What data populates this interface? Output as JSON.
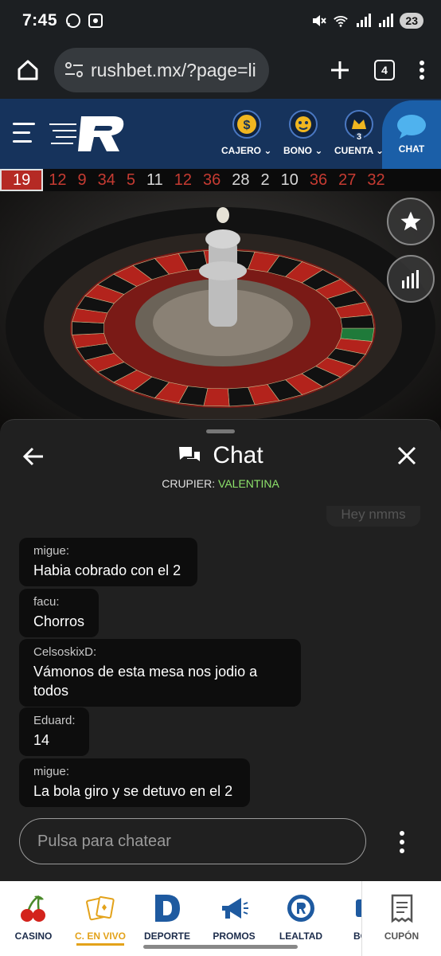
{
  "status_bar": {
    "time": "7:45",
    "battery": "23"
  },
  "browser": {
    "url": "rushbet.mx/?page=li",
    "tab_count": "4"
  },
  "header": {
    "nav": [
      {
        "label": "CAJERO",
        "icon": "dollar-coin-icon"
      },
      {
        "label": "BONO",
        "icon": "bonus-icon"
      },
      {
        "label": "CUENTA",
        "icon": "account-badge-icon",
        "badge": "3"
      }
    ],
    "chat_label": "CHAT"
  },
  "results": [
    {
      "n": "19",
      "color": "red"
    },
    {
      "n": "12",
      "color": "red"
    },
    {
      "n": "9",
      "color": "red"
    },
    {
      "n": "34",
      "color": "red"
    },
    {
      "n": "5",
      "color": "red"
    },
    {
      "n": "11",
      "color": "black"
    },
    {
      "n": "12",
      "color": "red"
    },
    {
      "n": "36",
      "color": "red"
    },
    {
      "n": "28",
      "color": "black"
    },
    {
      "n": "2",
      "color": "black"
    },
    {
      "n": "10",
      "color": "black"
    },
    {
      "n": "36",
      "color": "red"
    },
    {
      "n": "27",
      "color": "red"
    },
    {
      "n": "32",
      "color": "red"
    }
  ],
  "chat": {
    "title": "Chat",
    "dealer_label": "CRUPIER:",
    "dealer_name": "VALENTINA",
    "ghost_message": "Hey nmms",
    "messages": [
      {
        "user": "migue:",
        "text": "Habia cobrado con el 2"
      },
      {
        "user": "facu:",
        "text": "Chorros"
      },
      {
        "user": "CelsoskixD:",
        "text": "Vámonos de esta mesa nos jodio a todos"
      },
      {
        "user": "Eduard:",
        "text": "14"
      },
      {
        "user": "migue:",
        "text": "La bola giro y se detuvo en el 2"
      }
    ],
    "input_placeholder": "Pulsa para chatear"
  },
  "bottom_nav": [
    {
      "label": "CASINO",
      "icon": "cherries-icon"
    },
    {
      "label": "C. EN VIVO",
      "icon": "live-cards-icon",
      "active": true
    },
    {
      "label": "DEPORTE",
      "icon": "deporte-d-icon"
    },
    {
      "label": "PROMOS",
      "icon": "megaphone-icon"
    },
    {
      "label": "LEALTAD",
      "icon": "loyalty-badge-icon"
    },
    {
      "label": "BONO",
      "icon": "bonus-gift-icon"
    }
  ],
  "cupon_label": "CUPÓN",
  "colors": {
    "header_blue": "#16335c",
    "chat_blue": "#1b5fa8",
    "accent_gold": "#e3a21a",
    "dealer_green": "#8ee36b",
    "red_number": "#c63b32"
  }
}
